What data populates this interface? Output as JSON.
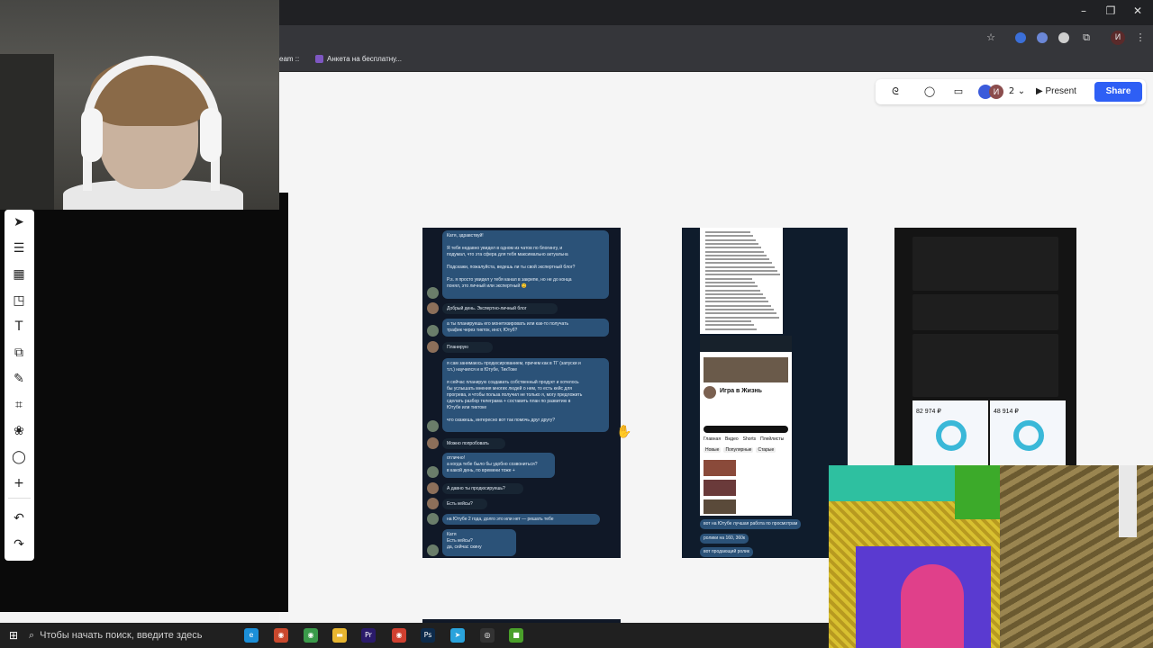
{
  "bookmarks": {
    "item1": "eam :: ",
    "item2": "Анкета на бесплатну..."
  },
  "window": {
    "min": "–",
    "restore": "❐",
    "close": "✕"
  },
  "browser_icons": {
    "star": "☆",
    "extensions": "⧉",
    "profile": "И",
    "menu": "⋮"
  },
  "topbar": {
    "reactions_icon": "ᘓ",
    "comment_icon": "◯",
    "video_icon": "▭",
    "avatar_letter": "И",
    "collaborators_count": "2",
    "chevron": "⌄",
    "present_label": "▶  Present",
    "share_label": "Share",
    "colors": {
      "share_bg": "#2e5ff5",
      "avatar1": "#3b5bdb",
      "avatar2": "#8b4d4d"
    }
  },
  "tools": {
    "items": [
      {
        "name": "select-tool",
        "glyph": "➤"
      },
      {
        "name": "templates-tool",
        "glyph": "☰"
      },
      {
        "name": "frame-tool",
        "glyph": "▦"
      },
      {
        "name": "sticky-note-tool",
        "glyph": "◳"
      },
      {
        "name": "text-tool",
        "glyph": "T"
      },
      {
        "name": "shapes-tool",
        "glyph": "⧉"
      },
      {
        "name": "pen-tool",
        "glyph": "✎"
      },
      {
        "name": "crop-tool",
        "glyph": "⌗"
      },
      {
        "name": "stencil-tool",
        "glyph": "❀"
      },
      {
        "name": "comment-tool",
        "glyph": "◯"
      },
      {
        "name": "add-tool",
        "glyph": "+"
      },
      {
        "name": "undo-tool",
        "glyph": "↶"
      },
      {
        "name": "redo-tool",
        "glyph": "↷"
      }
    ]
  },
  "chat": {
    "messages": [
      {
        "text": "Катя, здравствуй!\n\nЯ тебя недавно увидел в одном из чатов по блогингу, и\nподумал, что эта сфера для тебя максимально актуальна\n\nПодскажи, пожалуйста, ведешь ли ты свой экспертный блог?\n\nP.s. я просто увидел у тебя канал в закрепе, но не до конца\nпонял, это личный или экспертный 😊",
        "out": true
      },
      {
        "text": "Добрый день. Экспертно-личный блог",
        "out": false
      },
      {
        "text": "а ты планируешь его монетизировать или как-то получать\nтрафик через тикток, инст, Ютуб?",
        "out": true
      },
      {
        "text": "Планирую",
        "out": false
      },
      {
        "text": "я сам занимаюсь продюсированием, причем как в ТГ (запуски и\nт.п.) научился и в Ютубе, ТикТоке\n\nя сейчас планирую создавать собственный продукт и хотелось\nбы услышать мнения многих людей о нем, то есть кейс для\nпрогрева, и чтобы польза получил не только я, могу предложить\nсделать разбор телеграма + составить план по развитию в\nЮтубе или тиктоке\n\nчто скажешь, интересно вот так помочь друг другу?",
        "out": true
      },
      {
        "text": "Можно попробовать",
        "out": false
      },
      {
        "text": "отлично!\nа когда тебе было бы удобно созвониться?\nв какой день, по времени тоже +",
        "out": true
      },
      {
        "text": "А давно ты продюсируешь?",
        "out": false
      },
      {
        "text": "Есть кейсы?",
        "out": false
      },
      {
        "text": "на Ютубе 2 года, долго это или нет — решать тебе",
        "out": true
      },
      {
        "text": "Катя\nЕсть кейсы?\nда, сейчас скину",
        "out": true
      }
    ]
  },
  "mid": {
    "channel_title": "Игра в Жизнь",
    "tabs": [
      "Главная",
      "Видео",
      "Shorts",
      "Плейлисты"
    ],
    "chips": [
      "Новые",
      "Популярные",
      "Старые"
    ],
    "messages": [
      "вот на Ютубе лучшая работа по просмотрам",
      "ролики на 160, 360к",
      "вот продающий ролик"
    ]
  },
  "dash": {
    "card1_value": "82 974 ₽",
    "card2_value": "48 914 ₽"
  },
  "taskbar": {
    "search_placeholder": "Чтобы начать поиск, введите здесь",
    "icons": [
      {
        "name": "edge-icon",
        "glyph": "e",
        "color": "#1c8fd8"
      },
      {
        "name": "chrome-icon",
        "glyph": "◉",
        "color": "#c9482d"
      },
      {
        "name": "chrome-alt-icon",
        "glyph": "◉",
        "color": "#3a9a4a"
      },
      {
        "name": "folder-icon",
        "glyph": "▬",
        "color": "#e8b630"
      },
      {
        "name": "premiere-icon",
        "glyph": "Pr",
        "color": "#2a1a6a"
      },
      {
        "name": "chrome-second-icon",
        "glyph": "◉",
        "color": "#d04030"
      },
      {
        "name": "photoshop-icon",
        "glyph": "Ps",
        "color": "#0d2a4a"
      },
      {
        "name": "telegram-icon",
        "glyph": "➤",
        "color": "#2aa3dc"
      },
      {
        "name": "obs-icon",
        "glyph": "◎",
        "color": "#333"
      },
      {
        "name": "minecraft-icon",
        "glyph": "■",
        "color": "#4aa02a"
      }
    ]
  }
}
